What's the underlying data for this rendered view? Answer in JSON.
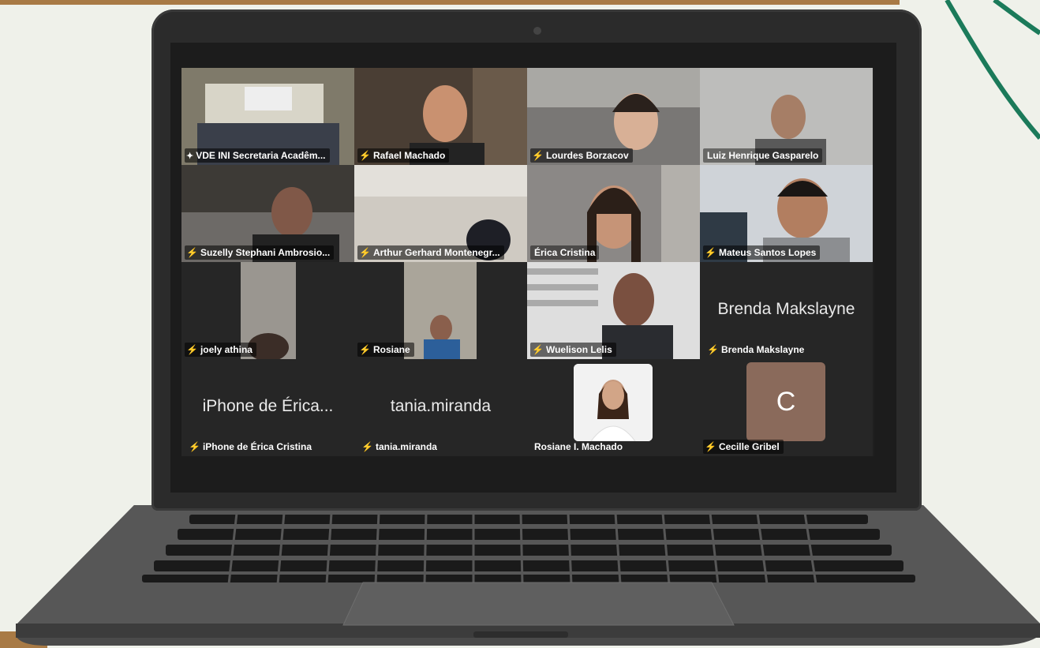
{
  "participants": [
    {
      "name": "VDE INI Secretaria Acadêm...",
      "pinned": true,
      "muted": false,
      "active": true
    },
    {
      "name": "Rafael Machado",
      "muted": true
    },
    {
      "name": "Lourdes Borzacov",
      "muted": true
    },
    {
      "name": "Luiz Henrique Gasparelo",
      "muted": false
    },
    {
      "name": "Suzelly Stephani Ambrosio...",
      "muted": true
    },
    {
      "name": "Arthur Gerhard Montenegr...",
      "muted": true
    },
    {
      "name": "Érica Cristina",
      "muted": false
    },
    {
      "name": "Mateus Santos Lopes",
      "muted": true
    },
    {
      "name": "joely athina",
      "muted": true
    },
    {
      "name": "Rosiane",
      "muted": true
    },
    {
      "name": "Wuelison Lelis",
      "muted": true
    },
    {
      "name": "Brenda Makslayne",
      "display_name": "Brenda Makslayne",
      "muted": true
    },
    {
      "name": "iPhone de Érica Cristina",
      "display_name": "iPhone de Érica...",
      "muted": true
    },
    {
      "name": "tania.miranda",
      "display_name": "tania.miranda",
      "muted": true
    },
    {
      "name": "Rosiane I. Machado",
      "muted": false
    },
    {
      "name": "Cecille Gribel",
      "avatar_letter": "C",
      "muted": true
    }
  ],
  "colors": {
    "active_border": "#3fd13f",
    "muted_icon": "#e0313a",
    "avatar_bg": "#8a6a5b"
  },
  "icons": {
    "muted": "mic-off-icon",
    "pin": "pin-icon"
  }
}
